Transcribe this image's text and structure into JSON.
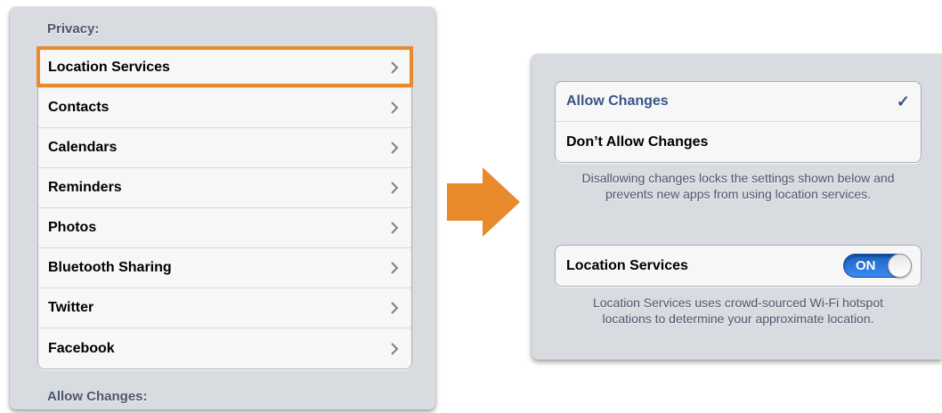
{
  "privacy": {
    "header": "Privacy:",
    "items": [
      {
        "label": "Location Services"
      },
      {
        "label": "Contacts"
      },
      {
        "label": "Calendars"
      },
      {
        "label": "Reminders"
      },
      {
        "label": "Photos"
      },
      {
        "label": "Bluetooth Sharing"
      },
      {
        "label": "Twitter"
      },
      {
        "label": "Facebook"
      }
    ],
    "next_header": "Allow Changes:"
  },
  "restrictions": {
    "options": [
      {
        "label": "Allow Changes",
        "selected": true
      },
      {
        "label": "Don’t Allow Changes",
        "selected": false
      }
    ],
    "options_footer": "Disallowing changes locks the settings shown below and prevents new apps from using location services.",
    "location_services": {
      "label": "Location Services",
      "switch_text": "ON",
      "enabled": true
    },
    "location_footer": "Location Services uses crowd-sourced Wi-Fi hotspot locations to determine your approximate location."
  },
  "icons": {
    "chevron": "chevron-right-icon",
    "check": "checkmark-icon",
    "arrow": "arrow-right-icon"
  },
  "colors": {
    "highlight": "#e8892b",
    "arrow": "#e8892b",
    "switch_on": "#2a78e4",
    "selected_text": "#385487",
    "panel_bg": "#d8dbe0"
  }
}
